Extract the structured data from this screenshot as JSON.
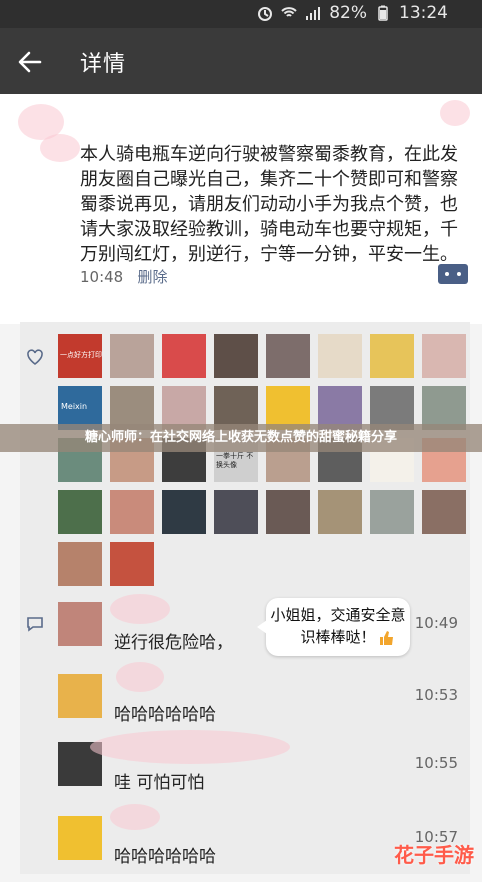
{
  "status_bar": {
    "battery_text": "82%",
    "time": "13:24"
  },
  "app_bar": {
    "title": "详情"
  },
  "post": {
    "text": "本人骑电瓶车逆向行驶被警察蜀黍教育，在此发朋友圈自己曝光自己，集齐二十个赞即可和警察蜀黍说再见，请朋友们动动小手为我点个赞，也请大家汲取经验教训，骑电动车也要守规矩，千万别闯红灯，别逆行，宁等一分钟，平安一生。",
    "time": "10:48",
    "delete_label": "删除"
  },
  "overlay_banner": "糖心师师：在社交网络上收获无数点赞的甜蜜秘籍分享",
  "likes": {
    "avatars": [
      {
        "color": "#c23a2d"
      },
      {
        "color": "#b9a39a"
      },
      {
        "color": "#d94b4b"
      },
      {
        "color": "#5e4f48"
      },
      {
        "color": "#7d6d6b"
      },
      {
        "color": "#e6dac8"
      },
      {
        "color": "#e7c45a"
      },
      {
        "color": "#d9b7b1"
      },
      {
        "color": "#2f6a9c"
      },
      {
        "color": "#9b8d7e"
      },
      {
        "color": "#c8a8a6"
      },
      {
        "color": "#6f6257"
      },
      {
        "color": "#f0c030"
      },
      {
        "color": "#8a7aa5"
      },
      {
        "color": "#7b7b7b"
      },
      {
        "color": "#8f9a90"
      },
      {
        "color": "#6b8c7d"
      },
      {
        "color": "#c79b86"
      },
      {
        "color": "#3d3d3d"
      },
      {
        "color": "#cfcfcf"
      },
      {
        "color": "#ba9f8f"
      },
      {
        "color": "#5e5e5e"
      },
      {
        "color": "#f4f1ea"
      },
      {
        "color": "#e6a18f"
      },
      {
        "color": "#4d6f4b"
      },
      {
        "color": "#c98b7b"
      },
      {
        "color": "#2f3a44"
      },
      {
        "color": "#4e4e58"
      },
      {
        "color": "#6a5a55"
      },
      {
        "color": "#a59377"
      },
      {
        "color": "#9aa29d"
      },
      {
        "color": "#8a6f64"
      },
      {
        "color": "#b6826b"
      },
      {
        "color": "#c5523f"
      }
    ],
    "avatar_text": {
      "food_label": "一点好方打印",
      "meixin_label": "Meixin",
      "yellow_label": "一拳十斤 不换头像"
    }
  },
  "comments": [
    {
      "text": "逆行很危险哈，",
      "time": "10:49",
      "avatar_color": "#c0857a"
    },
    {
      "text": "哈哈哈哈哈哈",
      "time": "10:53",
      "avatar_color": "#e8b24b"
    },
    {
      "text": "哇 可怕可怕",
      "time": "10:55",
      "avatar_color": "#3a3a3a"
    },
    {
      "text": "哈哈哈哈哈哈",
      "time": "10:57",
      "avatar_color": "#f0c030"
    }
  ],
  "reply_bubble": {
    "text": "小姐姐，交通安全意识棒棒哒！"
  },
  "watermark": "花子手游"
}
